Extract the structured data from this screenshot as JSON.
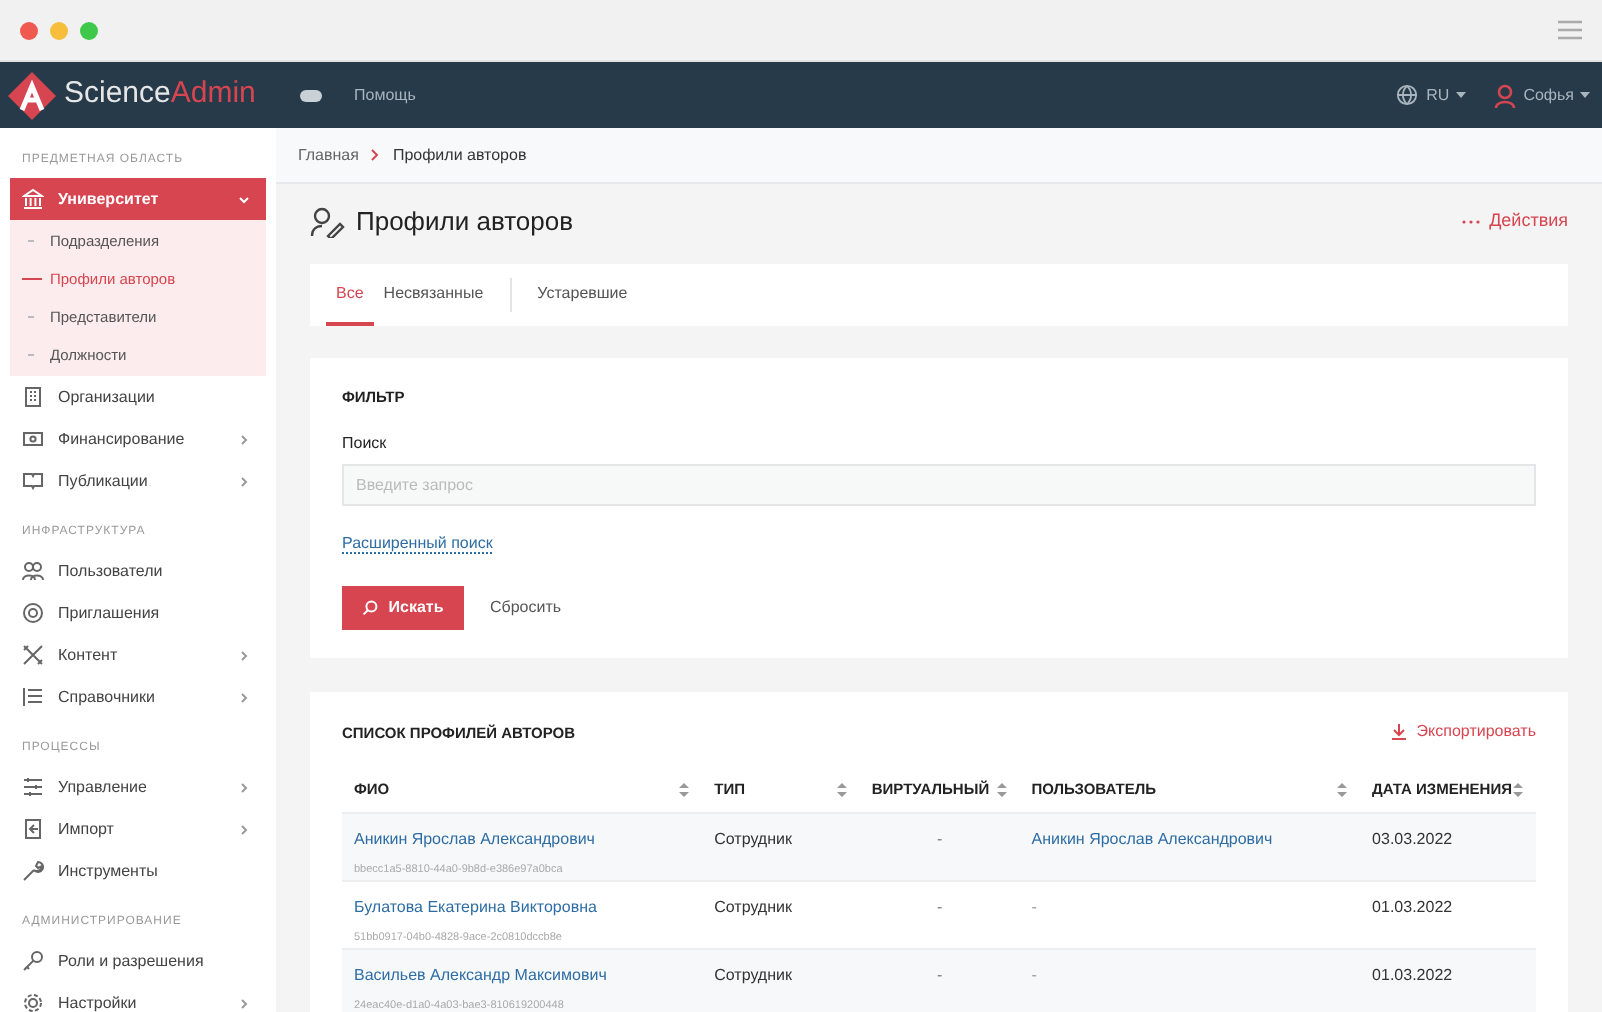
{
  "header": {
    "logo_primary": "Science",
    "logo_accent": "Admin",
    "help": "Помощь",
    "language": "RU",
    "user": "Софья"
  },
  "sidebar": {
    "sections": [
      {
        "title": "ПРЕДМЕТНАЯ ОБЛАСТЬ",
        "items": [
          {
            "kind": "bank",
            "label": "Университет",
            "selected": true,
            "expanded": true,
            "children": [
              {
                "label": "Подразделения",
                "selected": false
              },
              {
                "label": "Профили авторов",
                "selected": true
              },
              {
                "label": "Представители",
                "selected": false
              },
              {
                "label": "Должности",
                "selected": false
              }
            ]
          },
          {
            "kind": "building",
            "label": "Организации",
            "selected": false
          },
          {
            "kind": "money",
            "label": "Финансирование",
            "selected": false,
            "expanded": false
          },
          {
            "kind": "book",
            "label": "Публикации",
            "selected": false,
            "expanded": false
          }
        ]
      },
      {
        "title": "ИНФРАСТРУКТУРА",
        "items": [
          {
            "kind": "users",
            "label": "Пользователи",
            "selected": false
          },
          {
            "kind": "at",
            "label": "Приглашения",
            "selected": false
          },
          {
            "kind": "tools",
            "label": "Контент",
            "selected": false,
            "expanded": false
          },
          {
            "kind": "list",
            "label": "Справочники",
            "selected": false,
            "expanded": false
          }
        ]
      },
      {
        "title": "ПРОЦЕССЫ",
        "items": [
          {
            "kind": "sliders",
            "label": "Управление",
            "selected": false,
            "expanded": false
          },
          {
            "kind": "import",
            "label": "Импорт",
            "selected": false,
            "expanded": false
          },
          {
            "kind": "wrench",
            "label": "Инструменты",
            "selected": false
          }
        ]
      },
      {
        "title": "АДМИНИСТРИРОВАНИЕ",
        "items": [
          {
            "kind": "key",
            "label": "Роли и разрешения",
            "selected": false
          },
          {
            "kind": "gear",
            "label": "Настройки",
            "selected": false,
            "expanded": false
          }
        ]
      }
    ]
  },
  "breadcrumbs": [
    "Главная",
    "Профили авторов"
  ],
  "page_title": "Профили авторов",
  "actions": "Действия",
  "tabs": [
    {
      "label": "Все",
      "selected": true
    },
    {
      "label": "Несвязанные",
      "selected": false
    },
    {
      "label": "Устаревшие",
      "selected": false
    }
  ],
  "filter": {
    "title": "ФИЛЬТР",
    "search_label": "Поиск",
    "placeholder": "Введите запрос",
    "advanced_link": "Расширенный поиск",
    "search_button": "Искать",
    "reset_button": "Сбросить"
  },
  "list": {
    "title": "СПИСОК ПРОФИЛЕЙ АВТОРОВ",
    "export": "Экспортировать",
    "columns": [
      "ФИО",
      "ТИП",
      "ВИРТУАЛЬНЫЙ",
      "ПОЛЬЗОВАТЕЛЬ",
      "ДАТА ИЗМЕНЕНИЯ"
    ],
    "rows": [
      {
        "name": "Аникин Ярослав Александрович",
        "id": "bbecc1a5-8810-44a0-9b8d-e386e97a0bca",
        "type": "Сотрудник",
        "virtual": "-",
        "user": "Аникин Ярослав Александрович",
        "user_linked": true,
        "date": "03.03.2022"
      },
      {
        "name": "Булатова Екатерина Викторовна",
        "id": "51bb0917-04b0-4828-9ace-2c0810dccb8e",
        "type": "Сотрудник",
        "virtual": "-",
        "user": "-",
        "user_linked": false,
        "date": "01.03.2022"
      },
      {
        "name": "Васильев Александр Максимович",
        "id": "24eac40e-d1a0-4a03-bae3-810619200448",
        "type": "Сотрудник",
        "virtual": "-",
        "user": "-",
        "user_linked": false,
        "date": "01.03.2022"
      }
    ]
  }
}
